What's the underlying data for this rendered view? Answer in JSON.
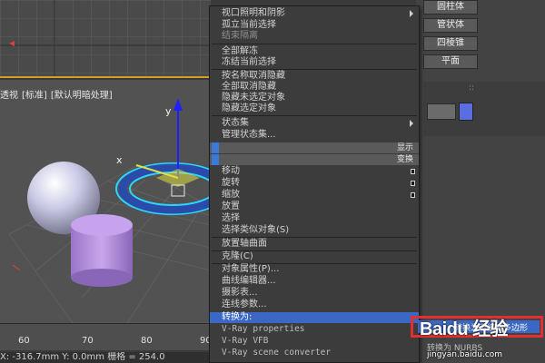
{
  "viewport": {
    "labels": [
      "透视",
      "[标准]",
      "[默认明暗处理]"
    ],
    "axis_x": "x",
    "axis_y": "y"
  },
  "command_panel": {
    "buttons": [
      "圆柱体",
      "管状体",
      "四棱锥",
      "平面"
    ],
    "swatch_color": "#5a6ee0"
  },
  "menu": {
    "group1": [
      {
        "label": "视口照明和阴影",
        "submenu": true
      },
      {
        "label": "孤立当前选择"
      },
      {
        "label": "结束隔离",
        "dim": true
      }
    ],
    "group2": [
      {
        "label": "全部解冻"
      },
      {
        "label": "冻结当前选择"
      }
    ],
    "group3": [
      {
        "label": "按名称取消隐藏"
      },
      {
        "label": "全部取消隐藏"
      },
      {
        "label": "隐藏未选定对象"
      },
      {
        "label": "隐藏选定对象"
      }
    ],
    "group4": [
      {
        "label": "状态集",
        "submenu": true
      },
      {
        "label": "管理状态集..."
      }
    ],
    "bar_display": "显示",
    "bar_transform": "变换",
    "group5": [
      {
        "label": "移动",
        "box": true
      },
      {
        "label": "旋转",
        "box": true
      },
      {
        "label": "缩放",
        "box": true
      },
      {
        "label": "放置"
      },
      {
        "label": "选择"
      },
      {
        "label": "选择类似对象(S)"
      }
    ],
    "group6": [
      {
        "label": "放置轴曲面"
      }
    ],
    "group7": [
      {
        "label": "克隆(C)"
      }
    ],
    "group8": [
      {
        "label": "对象属性(P)..."
      },
      {
        "label": "曲线编辑器..."
      },
      {
        "label": "摄影表..."
      },
      {
        "label": "连线参数..."
      }
    ],
    "highlighted": "转换为:",
    "group9": [
      {
        "label": "V-Ray properties"
      },
      {
        "label": "V-Ray VFB"
      },
      {
        "label": "V-Ray scene converter"
      }
    ]
  },
  "ruler": {
    "ticks": [
      "60",
      "70",
      "80",
      "90"
    ]
  },
  "status": {
    "text": "X: -316.7mm    Y: 0.0mm    栅格 = 254.0"
  },
  "watermark": {
    "logo": "Baidu 经验",
    "url": "jingyan.baidu.com"
  },
  "overlay_text": {
    "convert_nurbs": "转换为 NURBS",
    "convert_edit": "转换为可编辑多边形"
  }
}
